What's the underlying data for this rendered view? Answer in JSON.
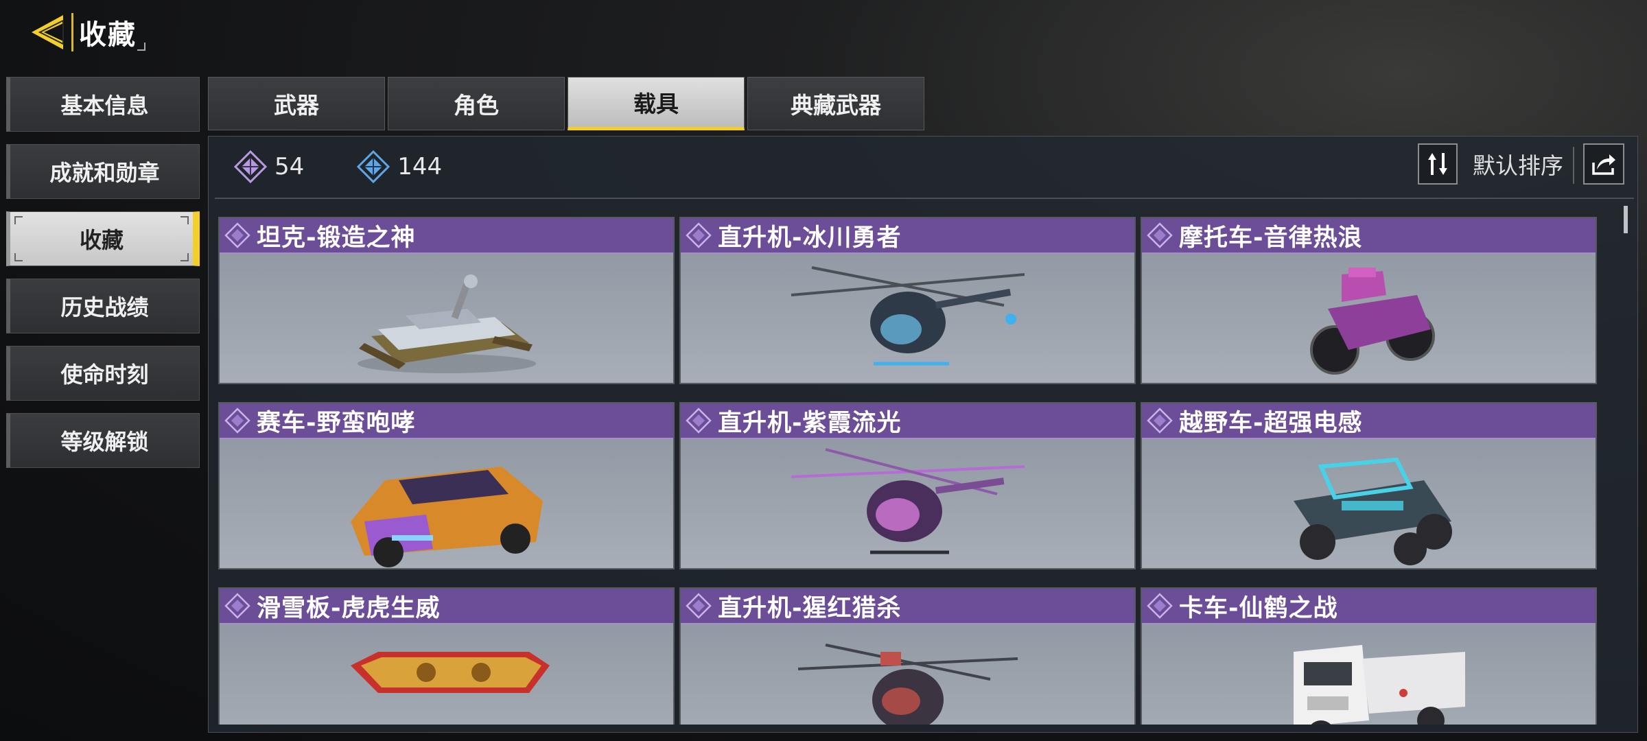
{
  "header": {
    "title": "收藏"
  },
  "sidebar": {
    "items": [
      {
        "label": "基本信息"
      },
      {
        "label": "成就和勋章"
      },
      {
        "label": "收藏"
      },
      {
        "label": "历史战绩"
      },
      {
        "label": "使命时刻"
      },
      {
        "label": "等级解锁"
      }
    ],
    "active_index": 2
  },
  "tabs": [
    {
      "label": "武器"
    },
    {
      "label": "角色"
    },
    {
      "label": "载具"
    },
    {
      "label": "典藏武器"
    }
  ],
  "active_tab": 2,
  "stats": {
    "purple_count": "54",
    "blue_count": "144"
  },
  "sort": {
    "label": "默认排序"
  },
  "items": [
    {
      "name": "坦克-锻造之神",
      "icon": "tank-icon"
    },
    {
      "name": "直升机-冰川勇者",
      "icon": "helicopter-icon"
    },
    {
      "name": "摩托车-音律热浪",
      "icon": "motorcycle-icon"
    },
    {
      "name": "赛车-野蛮咆哮",
      "icon": "race-car-icon"
    },
    {
      "name": "直升机-紫霞流光",
      "icon": "helicopter-icon"
    },
    {
      "name": "越野车-超强电感",
      "icon": "offroad-buggy-icon"
    },
    {
      "name": "滑雪板-虎虎生威",
      "icon": "snowboard-icon"
    },
    {
      "name": "直升机-猩红猎杀",
      "icon": "helicopter-icon"
    },
    {
      "name": "卡车-仙鹤之战",
      "icon": "truck-icon"
    }
  ],
  "colors": {
    "accent": "#f4cf2a",
    "card_header": "#6b4d98",
    "rarity_purple": "#b79be0",
    "rarity_blue": "#5fa6e6"
  }
}
